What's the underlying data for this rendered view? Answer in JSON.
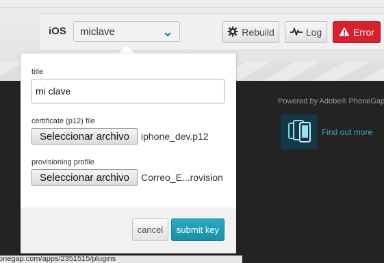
{
  "platform": {
    "name": "iOS",
    "selected_key": "miclave",
    "rebuild_label": "Rebuild",
    "log_label": "Log",
    "error_label": "Error"
  },
  "sidebar": {
    "powered_by": "Powered by Adobe® PhoneGap™",
    "find_more": "Find out more"
  },
  "form": {
    "title_label": "title",
    "title_value": "mi clave",
    "cert_label": "certificate (p12) file",
    "cert_button": "Seleccionar archivo",
    "cert_filename": "iphone_dev.p12",
    "prov_label": "provisioning profile",
    "prov_button": "Seleccionar archivo",
    "prov_filename": "Correo_E...rovision",
    "cancel_label": "cancel",
    "submit_label": "submit key"
  },
  "status_bar": {
    "url": "onegap.com/apps/2351515/plugins"
  },
  "colors": {
    "error": "#d9202f",
    "submit": "#1f9ab3",
    "link": "#3aa3c2",
    "dark_bg": "#232323"
  },
  "icons": {
    "rebuild": "gear-refresh-icon",
    "log": "pulse-icon",
    "error": "warning-icon",
    "select": "chevron-down-icon",
    "logo": "phonegap-logo"
  }
}
